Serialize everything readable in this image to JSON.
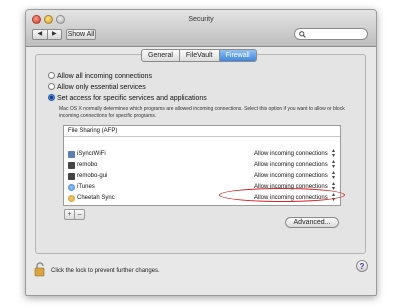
{
  "window": {
    "title": "Security"
  },
  "toolbar": {
    "back_icon": "◀",
    "forward_icon": "▶",
    "show_all_label": "Show All",
    "search_value": "",
    "search_placeholder": ""
  },
  "tabs": [
    {
      "label": "General"
    },
    {
      "label": "FileVault"
    },
    {
      "label": "Firewall",
      "active": true
    }
  ],
  "firewall": {
    "options": [
      {
        "label": "Allow all incoming connections",
        "selected": false
      },
      {
        "label": "Allow only essential services",
        "selected": false
      },
      {
        "label": "Set access for specific services and applications",
        "selected": true
      }
    ],
    "description": "Mac OS X normally determines which programs are allowed incoming connections. Select this option if you want to allow or block incoming connections for specific programs.",
    "list_header": "File Sharing (AFP)",
    "apps": [
      {
        "name": "iSyncrWiFi",
        "permission": "Allow incoming connections",
        "icon": "sync-icon"
      },
      {
        "name": "remobo",
        "permission": "Allow incoming connections",
        "icon": "app-icon"
      },
      {
        "name": "remobo-gui",
        "permission": "Allow incoming connections",
        "icon": "app-icon"
      },
      {
        "name": "iTunes",
        "permission": "Allow incoming connections",
        "icon": "itunes-icon"
      },
      {
        "name": "Cheetah Sync",
        "permission": "Allow incoming connections",
        "icon": "cheetah-icon"
      }
    ],
    "add_label": "+",
    "remove_label": "–",
    "advanced_label": "Advanced..."
  },
  "footer": {
    "lock_text": "Click the lock to prevent further changes.",
    "help_label": "?"
  },
  "colors": {
    "accent": "#3f87e0",
    "annotation": "#d82020"
  }
}
